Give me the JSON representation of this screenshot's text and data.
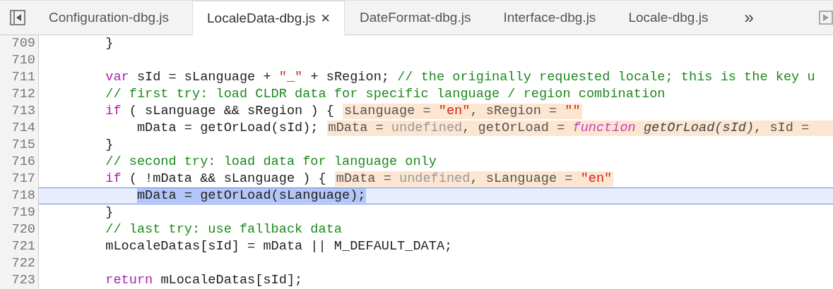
{
  "tabs": [
    {
      "label": "Configuration-dbg.js",
      "selected": false,
      "closable": false
    },
    {
      "label": "LocaleData-dbg.js",
      "selected": true,
      "closable": true
    },
    {
      "label": "DateFormat-dbg.js",
      "selected": false,
      "closable": false
    },
    {
      "label": "Interface-dbg.js",
      "selected": false,
      "closable": false
    },
    {
      "label": "Locale-dbg.js",
      "selected": false,
      "closable": false
    }
  ],
  "overflow_button": "»",
  "close_glyph": "×",
  "lines": [
    {
      "number": "709",
      "current": false,
      "tokens": [
        {
          "kind": "plain",
          "text": "        }"
        }
      ]
    },
    {
      "number": "710",
      "current": false
    },
    {
      "number": "711",
      "current": false,
      "tokens": [
        {
          "kind": "keyword",
          "text": "        var"
        },
        {
          "kind": "plain",
          "text": " sId = sLanguage + "
        },
        {
          "kind": "string",
          "text": "\"_\""
        },
        {
          "kind": "plain",
          "text": " + sRegion; "
        },
        {
          "kind": "comment",
          "text": "// the originally requested locale; this is the key u"
        }
      ]
    },
    {
      "number": "712",
      "current": false,
      "tokens": [
        {
          "kind": "comment",
          "text": "        // first try: load CLDR data for specific language / region combination"
        }
      ]
    },
    {
      "number": "713",
      "current": false,
      "tokens": [
        {
          "kind": "keyword",
          "text": "        if"
        },
        {
          "kind": "plain",
          "text": " ( sLanguage && sRegion ) {"
        }
      ],
      "inline_values": [
        {
          "kind": "plain",
          "text": "sLanguage = "
        },
        {
          "kind": "string",
          "text": "\"en\""
        },
        {
          "kind": "plain",
          "text": ", sRegion = "
        },
        {
          "kind": "string",
          "text": "\"\""
        }
      ]
    },
    {
      "number": "714",
      "current": false,
      "tokens": [
        {
          "kind": "plain",
          "text": "            mData = getOrLoad(sId);"
        }
      ],
      "inline_values": [
        {
          "kind": "plain",
          "text": "mData = "
        },
        {
          "kind": "undefined",
          "text": "undefined"
        },
        {
          "kind": "plain",
          "text": ", getOrLoad = "
        },
        {
          "kind": "function",
          "text": "function"
        },
        {
          "kind": "italic",
          "text": " getOrLoad(sId)"
        },
        {
          "kind": "plain",
          "text": ", sId ="
        }
      ]
    },
    {
      "number": "715",
      "current": false,
      "tokens": [
        {
          "kind": "plain",
          "text": "        }"
        }
      ]
    },
    {
      "number": "716",
      "current": false,
      "tokens": [
        {
          "kind": "comment",
          "text": "        // second try: load data for language only"
        }
      ]
    },
    {
      "number": "717",
      "current": false,
      "tokens": [
        {
          "kind": "keyword",
          "text": "        if"
        },
        {
          "kind": "plain",
          "text": " ( !mData && sLanguage ) {"
        }
      ],
      "inline_values": [
        {
          "kind": "plain",
          "text": "mData = "
        },
        {
          "kind": "undefined",
          "text": "undefined"
        },
        {
          "kind": "plain",
          "text": ", sLanguage = "
        },
        {
          "kind": "string",
          "text": "\"en\""
        }
      ]
    },
    {
      "number": "718",
      "current": true,
      "tokens": [
        {
          "kind": "plain",
          "text": "            mData = getOrLoad(sLanguage);"
        }
      ]
    },
    {
      "number": "719",
      "current": false,
      "tokens": [
        {
          "kind": "plain",
          "text": "        }"
        }
      ]
    },
    {
      "number": "720",
      "current": false,
      "tokens": [
        {
          "kind": "comment",
          "text": "        // last try: use fallback data"
        }
      ]
    },
    {
      "number": "721",
      "current": false,
      "tokens": [
        {
          "kind": "plain",
          "text": "        mLocaleDatas[sId] = mData || M_DEFAULT_DATA;"
        }
      ]
    },
    {
      "number": "722",
      "current": false
    },
    {
      "number": "723",
      "current": false,
      "tokens": [
        {
          "kind": "keyword",
          "text": "        return"
        },
        {
          "kind": "plain",
          "text": " mLocaleDatas[sId];"
        }
      ]
    }
  ]
}
